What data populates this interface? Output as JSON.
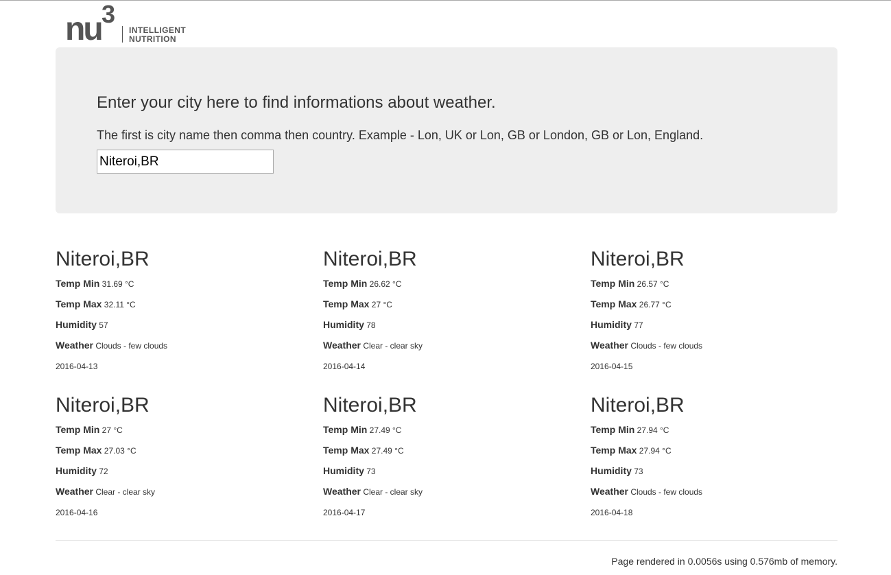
{
  "brand": {
    "logo_mark": "nu",
    "logo_superscript": "3",
    "logo_line1": "INTELLIGENT",
    "logo_line2": "NUTRITION"
  },
  "search": {
    "heading": "Enter your city here to find informations about weather.",
    "description": "The first is city name then comma then country. Example - Lon, UK or Lon, GB or London, GB or Lon, England.",
    "input_value": "Niteroi,BR"
  },
  "labels": {
    "temp_min": "Temp Min",
    "temp_max": "Temp Max",
    "humidity": "Humidity",
    "weather": "Weather"
  },
  "forecasts": [
    {
      "city": "Niteroi,BR",
      "temp_min": "31.69 °C",
      "temp_max": "32.11 °C",
      "humidity": "57",
      "weather": "Clouds - few clouds",
      "date": "2016-04-13"
    },
    {
      "city": "Niteroi,BR",
      "temp_min": "26.62 °C",
      "temp_max": "27 °C",
      "humidity": "78",
      "weather": "Clear - clear sky",
      "date": "2016-04-14"
    },
    {
      "city": "Niteroi,BR",
      "temp_min": "26.57 °C",
      "temp_max": "26.77 °C",
      "humidity": "77",
      "weather": "Clouds - few clouds",
      "date": "2016-04-15"
    },
    {
      "city": "Niteroi,BR",
      "temp_min": "27 °C",
      "temp_max": "27.03 °C",
      "humidity": "72",
      "weather": "Clear - clear sky",
      "date": "2016-04-16"
    },
    {
      "city": "Niteroi,BR",
      "temp_min": "27.49 °C",
      "temp_max": "27.49 °C",
      "humidity": "73",
      "weather": "Clear - clear sky",
      "date": "2016-04-17"
    },
    {
      "city": "Niteroi,BR",
      "temp_min": "27.94 °C",
      "temp_max": "27.94 °C",
      "humidity": "73",
      "weather": "Clouds - few clouds",
      "date": "2016-04-18"
    }
  ],
  "footer": {
    "text": "Page rendered in 0.0056s using 0.576mb of memory."
  }
}
